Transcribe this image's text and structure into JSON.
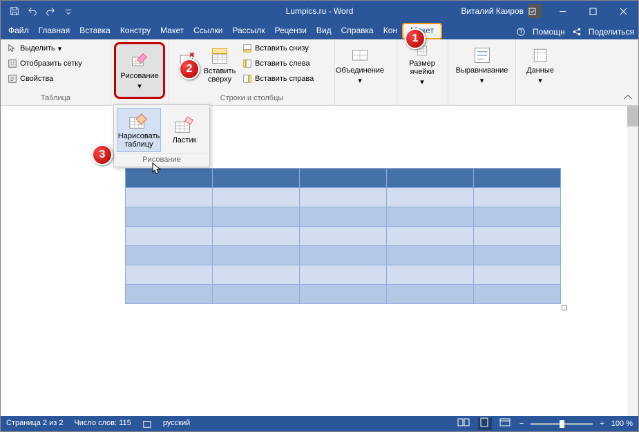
{
  "titlebar": {
    "title": "Lumpics.ru - Word",
    "user": "Виталий Каиров"
  },
  "tabs": {
    "items": [
      "Файл",
      "Главная",
      "Вставка",
      "Констру",
      "Макет",
      "Ссылки",
      "Рассылк",
      "Рецензи",
      "Вид",
      "Справка",
      "Кон"
    ],
    "layout_tab": "Макет",
    "tell_me": "Помощн",
    "share": "Поделиться"
  },
  "ribbon": {
    "table_group": {
      "select": "Выделить",
      "gridlines": "Отобразить сетку",
      "properties": "Свойства",
      "label": "Таблица"
    },
    "draw": {
      "label": "Рисование"
    },
    "rows_cols": {
      "insert_above": "Вставить сверху",
      "insert_below": "Вставить снизу",
      "insert_left": "Вставить слева",
      "insert_right": "Вставить справа",
      "label": "Строки и столбцы"
    },
    "merge": {
      "label": "Объединение"
    },
    "cellsize": {
      "label": "Размер ячейки"
    },
    "align": {
      "label": "Выравнивание"
    },
    "data": {
      "label": "Данные"
    }
  },
  "dropdown": {
    "draw_table": "Нарисовать таблицу",
    "eraser": "Ластик",
    "label": "Рисование"
  },
  "markers": {
    "m1": "1",
    "m2": "2",
    "m3": "3"
  },
  "statusbar": {
    "page": "Страница 2 из 2",
    "words": "Число слов: 115",
    "lang": "русский",
    "zoom": "100 %"
  }
}
